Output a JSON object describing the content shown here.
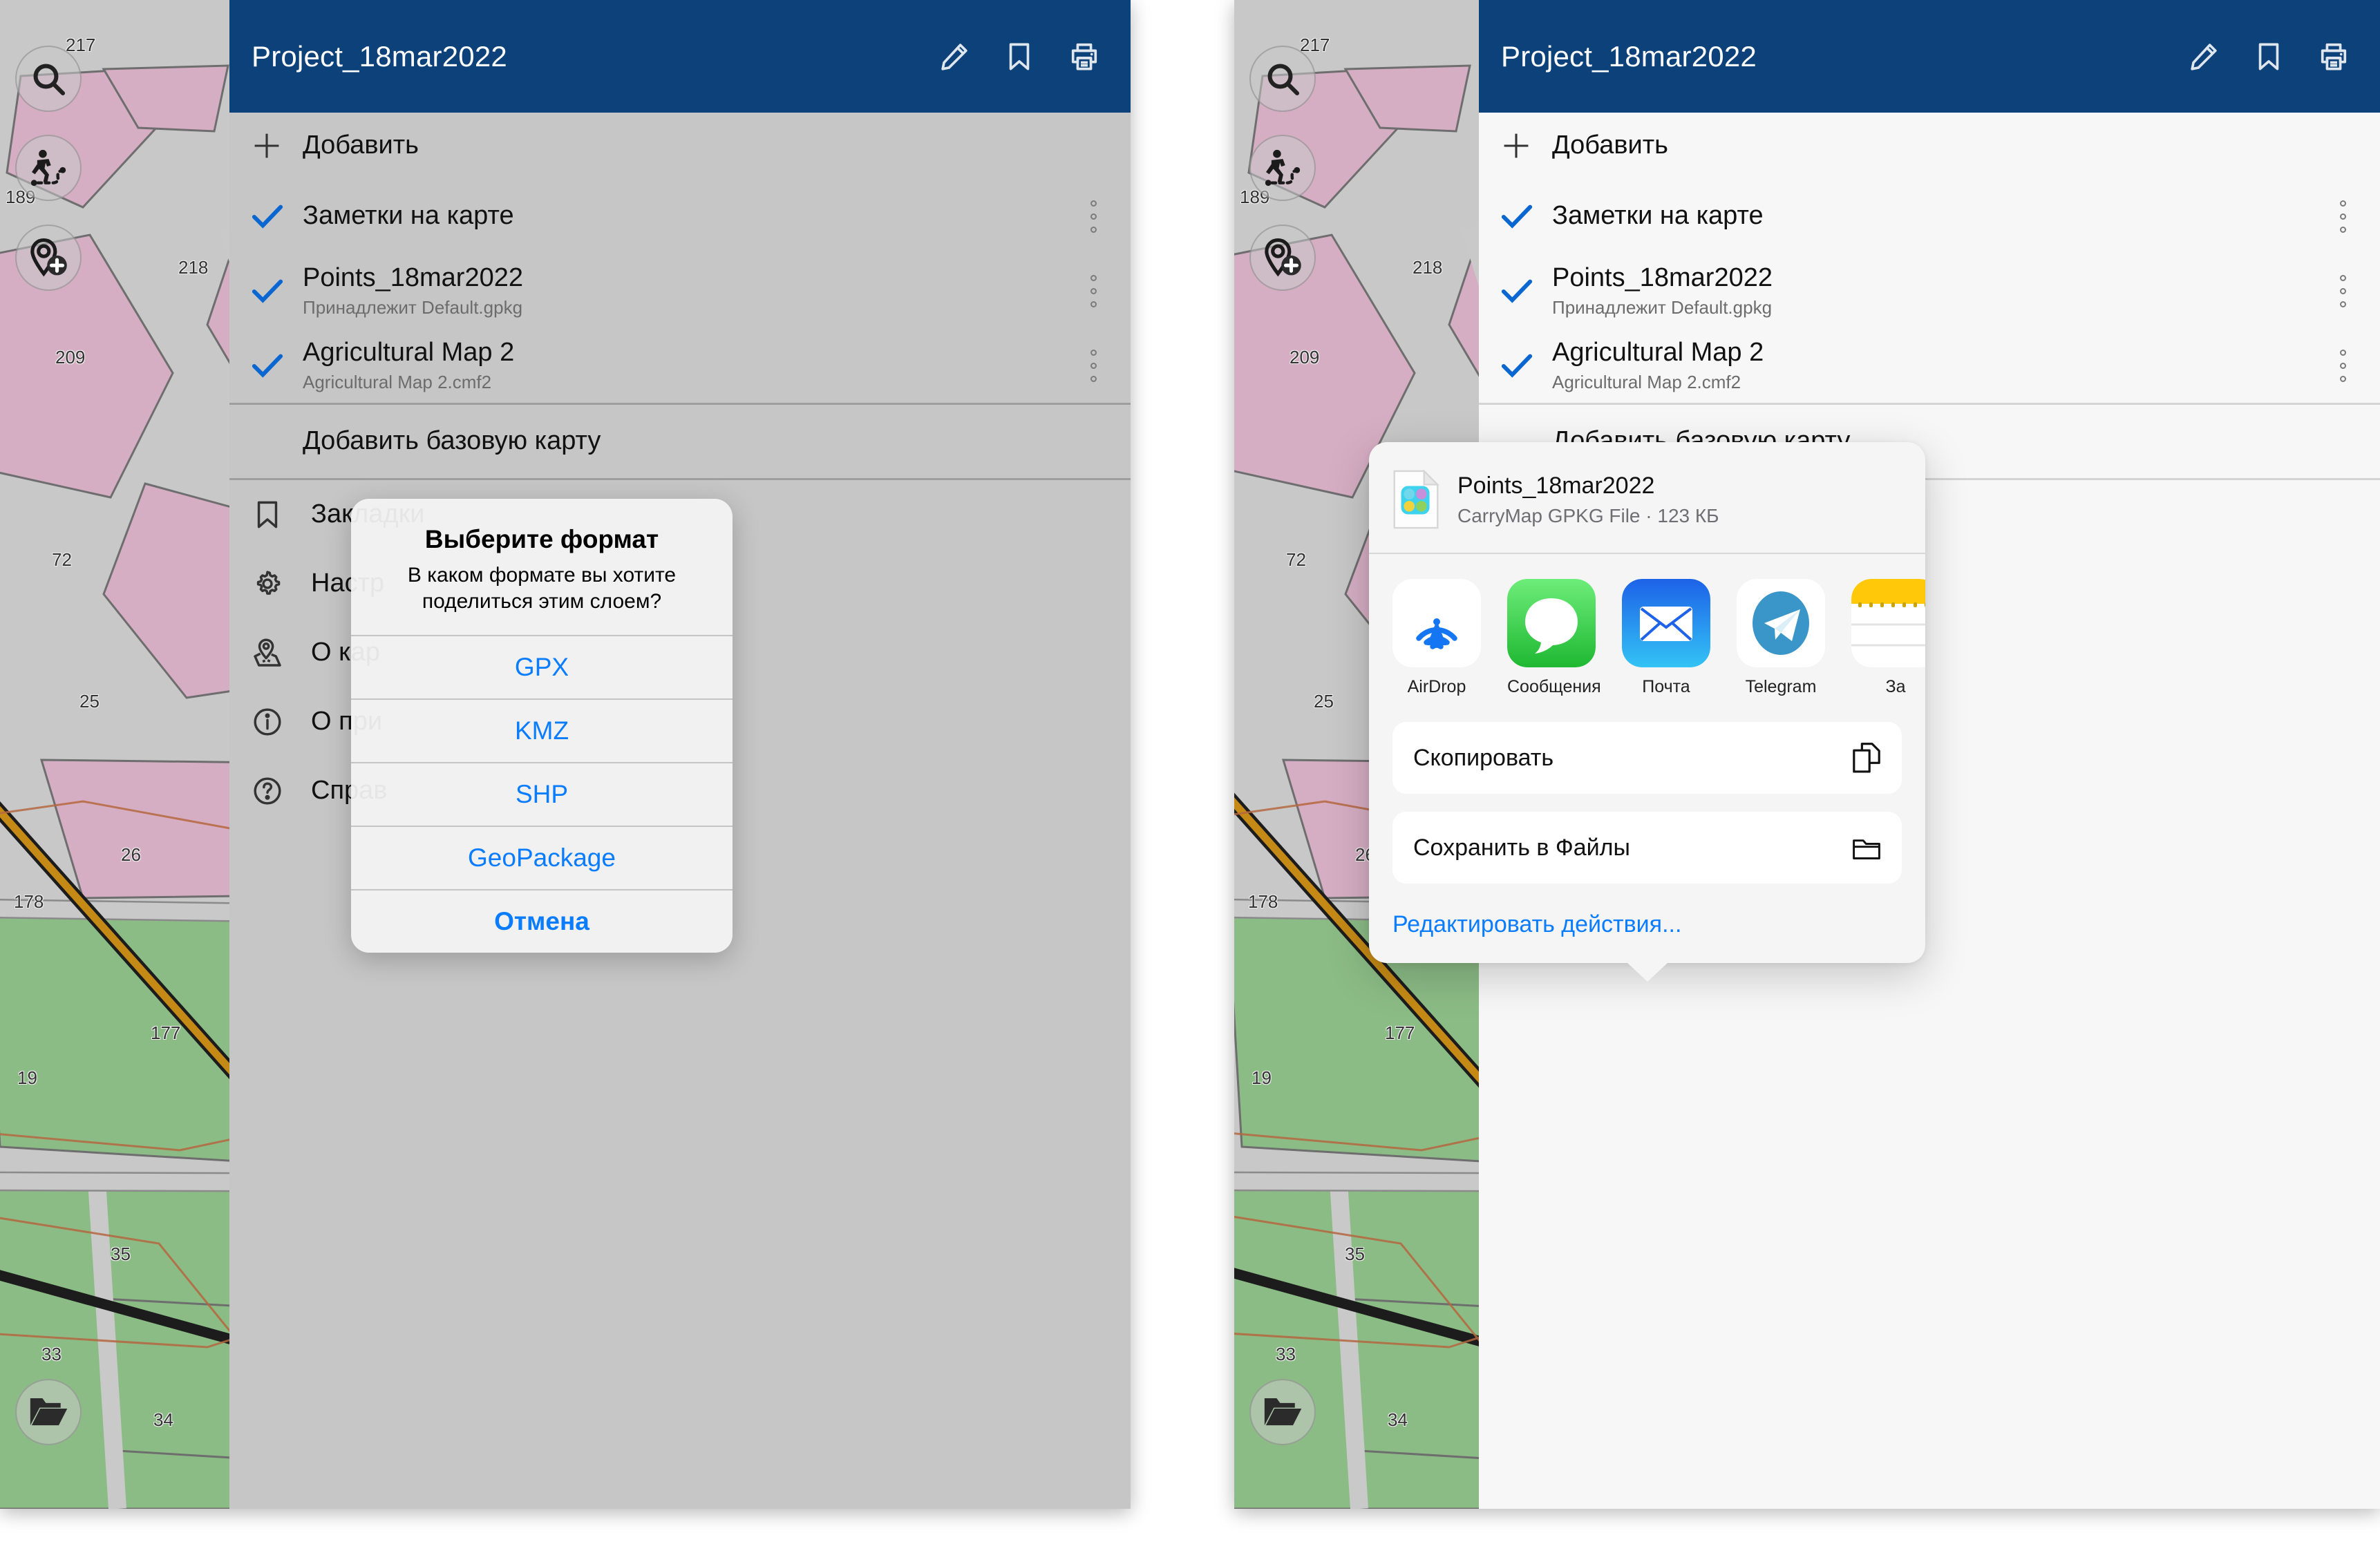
{
  "app": {
    "header": {
      "title": "Project_18mar2022",
      "icons": [
        "pencil-icon",
        "bookmark-icon",
        "print-icon"
      ]
    },
    "add_row": {
      "label": "Добавить",
      "icon": "plus-icon"
    },
    "layers": [
      {
        "label": "Заметки на карте",
        "sub": "",
        "checked": true
      },
      {
        "label": "Points_18mar2022",
        "sub": "Принадлежит Default.gpkg",
        "checked": true
      },
      {
        "label": "Agricultural Map 2",
        "sub": "Agricultural Map 2.cmf2",
        "checked": true
      }
    ],
    "basemap_row": {
      "label": "Добавить базовую карту"
    },
    "menu": [
      {
        "label": "Закладки",
        "icon": "bookmark-icon"
      },
      {
        "label": "Настройки",
        "icon": "gear-icon"
      },
      {
        "label": "О карте",
        "icon": "map-pin-icon"
      },
      {
        "label": "О приложении",
        "icon": "info-icon"
      },
      {
        "label": "Справка",
        "icon": "help-icon"
      }
    ],
    "menu_truncated": [
      {
        "label": "Закладки",
        "icon": "bookmark-icon"
      },
      {
        "label": "Настр",
        "icon": "gear-icon"
      },
      {
        "label": "О кар",
        "icon": "map-pin-icon"
      },
      {
        "label": "О при",
        "icon": "info-icon"
      },
      {
        "label": "Справ",
        "icon": "help-icon"
      }
    ],
    "map_buttons": [
      {
        "name": "search-icon"
      },
      {
        "name": "track-recording-icon"
      },
      {
        "name": "add-point-icon"
      },
      {
        "name": "open-folder-icon"
      }
    ],
    "map_labels": [
      "217",
      "189",
      "218",
      "209",
      "72",
      "25",
      "26",
      "178",
      "177",
      "19",
      "35",
      "33",
      "34"
    ]
  },
  "action_sheet": {
    "title": "Выберите формат",
    "message": "В каком формате вы хотите поделиться этим слоем?",
    "options": [
      "GPX",
      "KMZ",
      "SHP",
      "GeoPackage"
    ],
    "cancel": "Отмена"
  },
  "share_sheet": {
    "file": {
      "name": "Points_18mar2022",
      "meta": "CarryMap GPKG File · 123 КБ",
      "icon": "carrymap-gpkg-file-icon"
    },
    "apps": [
      {
        "name": "AirDrop",
        "icon": "airdrop-icon"
      },
      {
        "name": "Сообщения",
        "icon": "messages-icon"
      },
      {
        "name": "Почта",
        "icon": "mail-icon"
      },
      {
        "name": "Telegram",
        "icon": "telegram-icon"
      },
      {
        "name": "За",
        "icon": "notes-icon"
      }
    ],
    "actions": [
      {
        "label": "Скопировать",
        "icon": "copy-icon"
      },
      {
        "label": "Сохранить в Файлы",
        "icon": "folder-icon"
      }
    ],
    "edit_actions": "Редактировать действия..."
  },
  "colors": {
    "header_blue": "#0d4179",
    "accent_blue": "#0a7cff",
    "check_blue": "#0a66d0",
    "panel_dimmed": "#c6c6c6",
    "panel_light": "#f7f7f7",
    "map_gray": "#c8c8c8",
    "map_pink": "#d6aec3",
    "map_green": "#8cbc86",
    "map_water": "#9fb0d6",
    "map_road": "#c58a16"
  }
}
